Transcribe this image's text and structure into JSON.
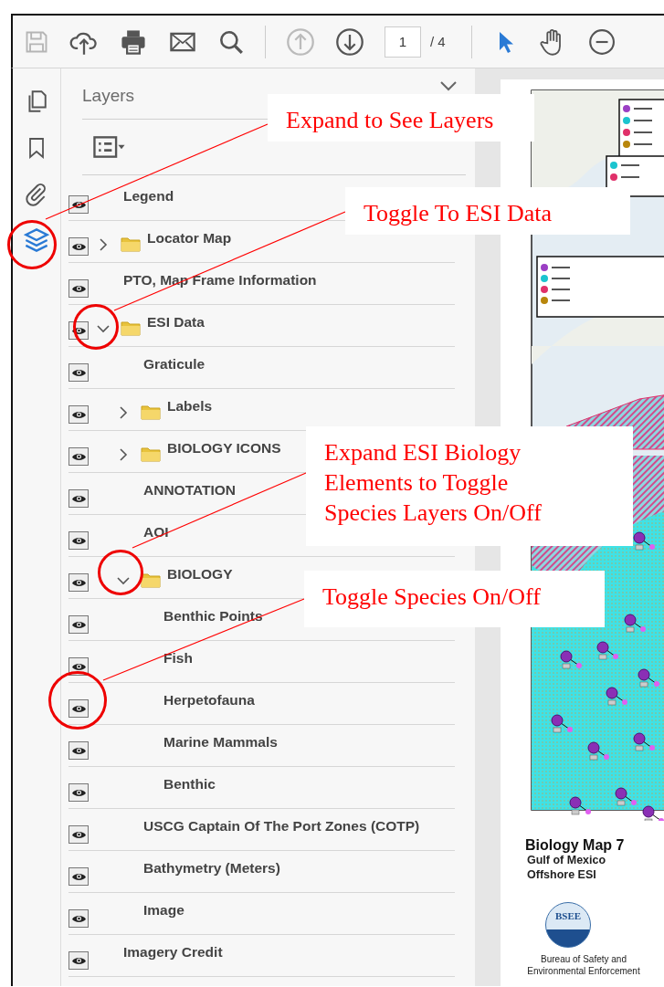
{
  "toolbar": {
    "page_number": "1",
    "page_count": "/ 4"
  },
  "layers_panel": {
    "title": "Layers",
    "items": [
      {
        "kind": "layer",
        "label": "Legend",
        "visible": true
      },
      {
        "kind": "folder",
        "label": "Locator Map",
        "visible": true,
        "expanded": false
      },
      {
        "kind": "layer",
        "label": "PTO, Map Frame Information",
        "visible": true
      },
      {
        "kind": "folder",
        "label": "ESI Data",
        "visible": true,
        "expanded": true,
        "children": [
          {
            "kind": "layer",
            "label": "Graticule",
            "visible": true
          },
          {
            "kind": "folder",
            "label": "Labels",
            "visible": true,
            "expanded": false
          },
          {
            "kind": "folder",
            "label": "BIOLOGY ICONS",
            "visible": true,
            "expanded": false
          },
          {
            "kind": "layer",
            "label": "ANNOTATION",
            "visible": true
          },
          {
            "kind": "layer",
            "label": "AOI",
            "visible": true
          },
          {
            "kind": "folder",
            "label": "BIOLOGY",
            "visible": true,
            "expanded": true,
            "children": [
              {
                "kind": "layer",
                "label": "Benthic Points",
                "visible": true
              },
              {
                "kind": "layer",
                "label": "Fish",
                "visible": true
              },
              {
                "kind": "layer",
                "label": "Herpetofauna",
                "visible": true
              },
              {
                "kind": "layer",
                "label": "Marine Mammals",
                "visible": true
              },
              {
                "kind": "layer",
                "label": "Benthic",
                "visible": true
              }
            ]
          },
          {
            "kind": "layer",
            "label": "USCG Captain Of The Port Zones (COTP)",
            "visible": true
          },
          {
            "kind": "layer",
            "label": "Bathymetry (Meters)",
            "visible": true
          },
          {
            "kind": "layer",
            "label": "Image",
            "visible": true
          }
        ]
      },
      {
        "kind": "layer",
        "label": "Imagery Credit",
        "visible": true
      }
    ]
  },
  "document": {
    "map_title": "Biology Map 7",
    "map_subtitle": [
      "Gulf of Mexico",
      "Offshore ESI"
    ],
    "logo_text": "BSEE",
    "agency": "Bureau of Safety and Environmental Enforcement"
  },
  "annotations": [
    {
      "text": "Expand to See Layers"
    },
    {
      "text": "Toggle To ESI Data"
    },
    {
      "text": "Expand ESI Biology Elements to Toggle Species Layers On/Off"
    },
    {
      "text": "Toggle Species On/Off"
    }
  ]
}
